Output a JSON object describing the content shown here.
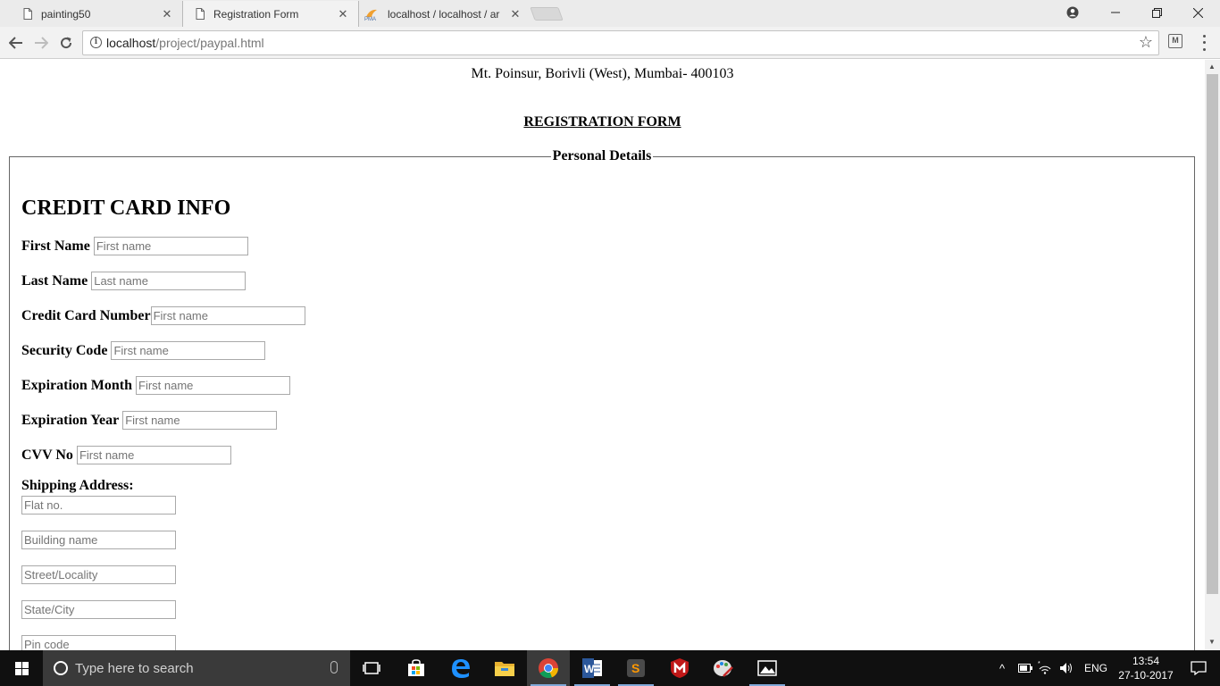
{
  "browser": {
    "tabs": [
      {
        "title": "painting50",
        "active": false
      },
      {
        "title": "Registration Form",
        "active": true
      },
      {
        "title": "localhost / localhost / ar",
        "active": false
      }
    ],
    "url_host": "localhost",
    "url_path": "/project/paypal.html"
  },
  "page": {
    "address_line": "Mt. Poinsur, Borivli (West), Mumbai- 400103",
    "form_title": "REGISTRATION FORM",
    "fieldset_legend": "Personal Details",
    "section_heading": "CREDIT CARD INFO",
    "fields": {
      "first_name": {
        "label": "First Name",
        "placeholder": "First name"
      },
      "last_name": {
        "label": "Last Name",
        "placeholder": "Last name"
      },
      "card_number": {
        "label": "Credit Card Number",
        "placeholder": "First name"
      },
      "security_code": {
        "label": "Security Code",
        "placeholder": "First name"
      },
      "exp_month": {
        "label": "Expiration Month",
        "placeholder": "First name"
      },
      "exp_year": {
        "label": "Expiration Year",
        "placeholder": "First name"
      },
      "cvv": {
        "label": "CVV No",
        "placeholder": "First name"
      }
    },
    "shipping": {
      "label": "Shipping Address:",
      "flat": "Flat no.",
      "building": "Building name",
      "street": "Street/Locality",
      "state_city": "State/City",
      "pin": "Pin code"
    }
  },
  "taskbar": {
    "search_placeholder": "Type here to search",
    "language": "ENG",
    "time": "13:54",
    "date": "27-10-2017"
  },
  "colors": {
    "taskbar": "#101010",
    "tab_active": "#f2f2f2",
    "tab_inactive": "#ebebeb"
  }
}
